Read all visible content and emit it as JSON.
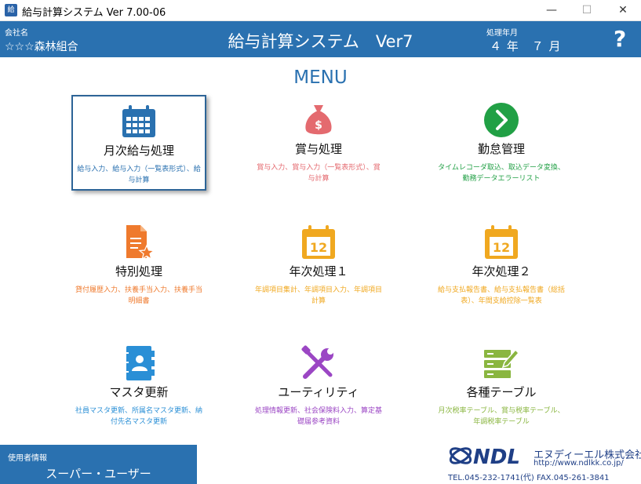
{
  "window": {
    "title": "給与計算システム  Ver 7.00-06",
    "min": "—",
    "max": "☐",
    "close": "✕"
  },
  "header": {
    "company_label": "会社名",
    "company": "☆☆☆森林組合",
    "title": "給与計算システム　Ver7",
    "period_label": "処理年月",
    "period": "４ 年　７ 月",
    "help": "?"
  },
  "menu_title": "MENU",
  "tiles": [
    {
      "label": "月次給与処理",
      "desc": "給与入力、給与入力（一覧表形式）、給与計算",
      "icon": "calendar-grid-icon",
      "color": "#2a71b0"
    },
    {
      "label": "賞与処理",
      "desc": "賞与入力、賞与入力（一覧表形式）、賞与計算",
      "icon": "money-bag-icon",
      "color": "#e46a6f"
    },
    {
      "label": "勤怠管理",
      "desc": "タイムレコーダ取込、取込データ変換、勤務データエラーリスト",
      "icon": "arrow-circle-icon",
      "color": "#21a045"
    },
    {
      "label": "特別処理",
      "desc": "貸付履歴入力、扶養手当入力、扶養手当明細書",
      "icon": "document-star-icon",
      "color": "#ef7a2d"
    },
    {
      "label": "年次処理１",
      "desc": "年調項目集計、年調項目入力、年調項目計算",
      "icon": "calendar-12-icon",
      "color": "#f0a820"
    },
    {
      "label": "年次処理２",
      "desc": "給与支払報告書、給与支払報告書（総括表）、年間支給控除一覧表",
      "icon": "calendar-12-icon",
      "color": "#f0a820"
    },
    {
      "label": "マスタ更新",
      "desc": "社員マスタ更新、所属名マスタ更新、納付先名マスタ更新",
      "icon": "address-book-icon",
      "color": "#2a8fd6"
    },
    {
      "label": "ユーティリティ",
      "desc": "処理情報更新、社会保険料入力、算定基礎届参考資料",
      "icon": "tools-icon",
      "color": "#9b46c4"
    },
    {
      "label": "各種テーブル",
      "desc": "月次税率テーブル、賞与税率テーブル、年調税率テーブル",
      "icon": "table-edit-icon",
      "color": "#8ab640"
    }
  ],
  "footer": {
    "user_label": "使用者情報",
    "user_name": "スーパー・ユーザー",
    "logo_text": "NDL",
    "company": "エヌディーエル株式会社",
    "url": "http://www.ndlkk.co.jp/",
    "tel": "TEL.045-232-1741(代) FAX.045-261-3841"
  }
}
